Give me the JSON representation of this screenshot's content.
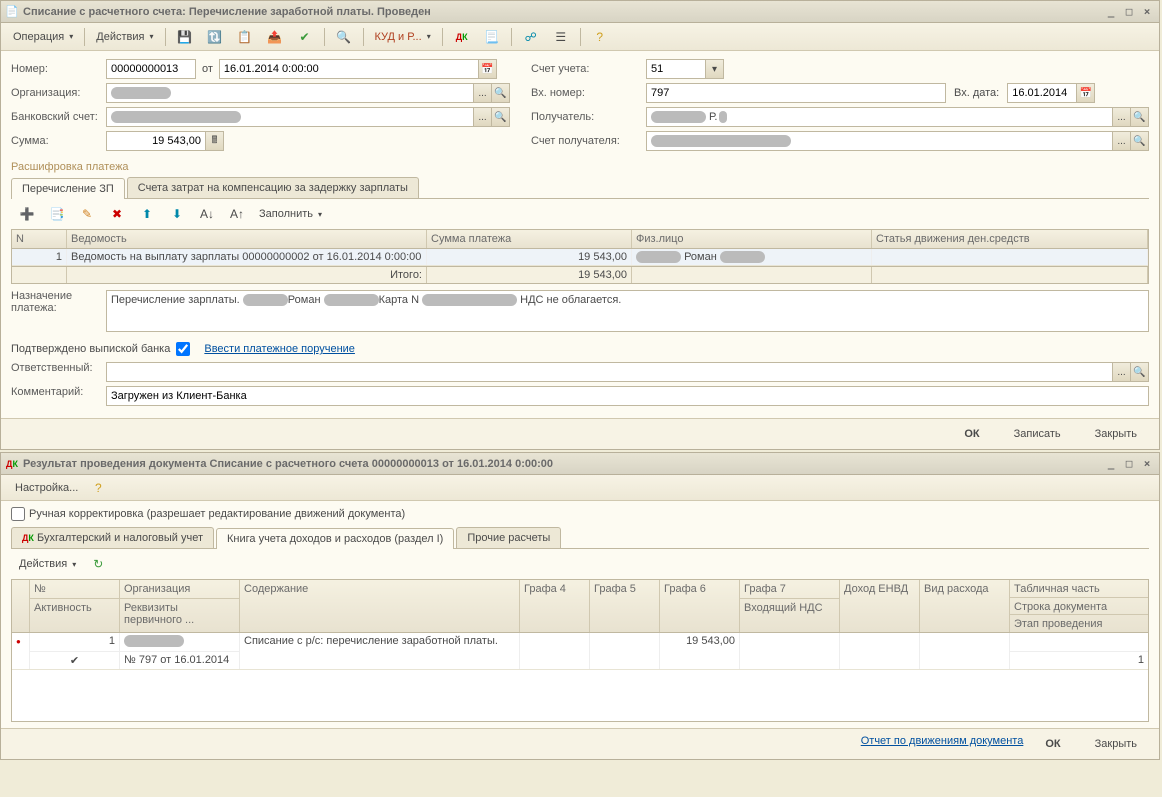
{
  "win1": {
    "title": "Списание с расчетного счета: Перечисление заработной платы. Проведен",
    "toolbar": {
      "operation": "Операция",
      "actions": "Действия",
      "kudir": "КУД и Р..."
    },
    "form": {
      "number_label": "Номер:",
      "number": "00000000013",
      "from_label": "от",
      "date": "16.01.2014 0:00:00",
      "org_label": "Организация:",
      "bank_label": "Банковский счет:",
      "sum_label": "Сумма:",
      "sum": "19 543,00",
      "account_label": "Счет учета:",
      "account": "51",
      "in_num_label": "Вх. номер:",
      "in_num": "797",
      "in_date_label": "Вх. дата:",
      "in_date": "16.01.2014",
      "recipient_label": "Получатель:",
      "recipient_account_label": "Счет получателя:"
    },
    "section_title": "Расшифровка платежа",
    "tabs": {
      "tab1": "Перечисление ЗП",
      "tab2": "Счета затрат на компенсацию за задержку зарплаты"
    },
    "subtoolbar": {
      "fill": "Заполнить"
    },
    "grid": {
      "h_n": "N",
      "h_statement": "Ведомость",
      "h_sum": "Сумма платежа",
      "h_person": "Физ.лицо",
      "h_article": "Статья движения ден.средств",
      "r_n": "1",
      "r_statement": "Ведомость на выплату зарплаты 00000000002 от 16.01.2014 0:00:00",
      "r_sum": "19 543,00",
      "r_person": "Роман",
      "total_label": "Итого:",
      "total_sum": "19 543,00"
    },
    "purpose_label": "Назначение платежа:",
    "purpose_pre": "Перечисление зарплаты.",
    "purpose_mid": "Роман",
    "purpose_card": "Карта N",
    "purpose_tail": "НДС не облагается.",
    "confirmed_label": "Подтверждено выпиской банка",
    "enter_payment": "Ввести платежное поручение",
    "responsible_label": "Ответственный:",
    "comment_label": "Комментарий:",
    "comment": "Загружен из Клиент-Банка",
    "footer": {
      "ok": "ОК",
      "write": "Записать",
      "close": "Закрыть"
    }
  },
  "win2": {
    "title": "Результат проведения документа Списание с расчетного счета 00000000013 от 16.01.2014 0:00:00",
    "settings": "Настройка...",
    "manual_correction": "Ручная корректировка (разрешает редактирование движений документа)",
    "tabs": {
      "t1": "Бухгалтерский и налоговый учет",
      "t2": "Книга учета доходов и расходов (раздел I)",
      "t3": "Прочие расчеты"
    },
    "actions": "Действия",
    "grid": {
      "h_num": "№",
      "h_activity": "Активность",
      "h_org": "Организация",
      "h_req": "Реквизиты первичного ...",
      "h_content": "Содержание",
      "h_g4": "Графа 4",
      "h_g5": "Графа 5",
      "h_g6": "Графа 6",
      "h_g7": "Графа 7",
      "h_g7_sub": "Входящий НДС",
      "h_income": "Доход ЕНВД",
      "h_expense": "Вид расхода",
      "h_table": "Табличная часть",
      "h_row": "Строка документа",
      "h_stage": "Этап проведения",
      "r_num": "1",
      "r_req": "№ 797 от 16.01.2014",
      "r_content": "Списание с р/с: перечисление заработной платы.",
      "r_g6": "19 543,00",
      "r_row": "1"
    },
    "footer": {
      "report": "Отчет по движениям документа",
      "ok": "ОК",
      "close": "Закрыть"
    }
  }
}
